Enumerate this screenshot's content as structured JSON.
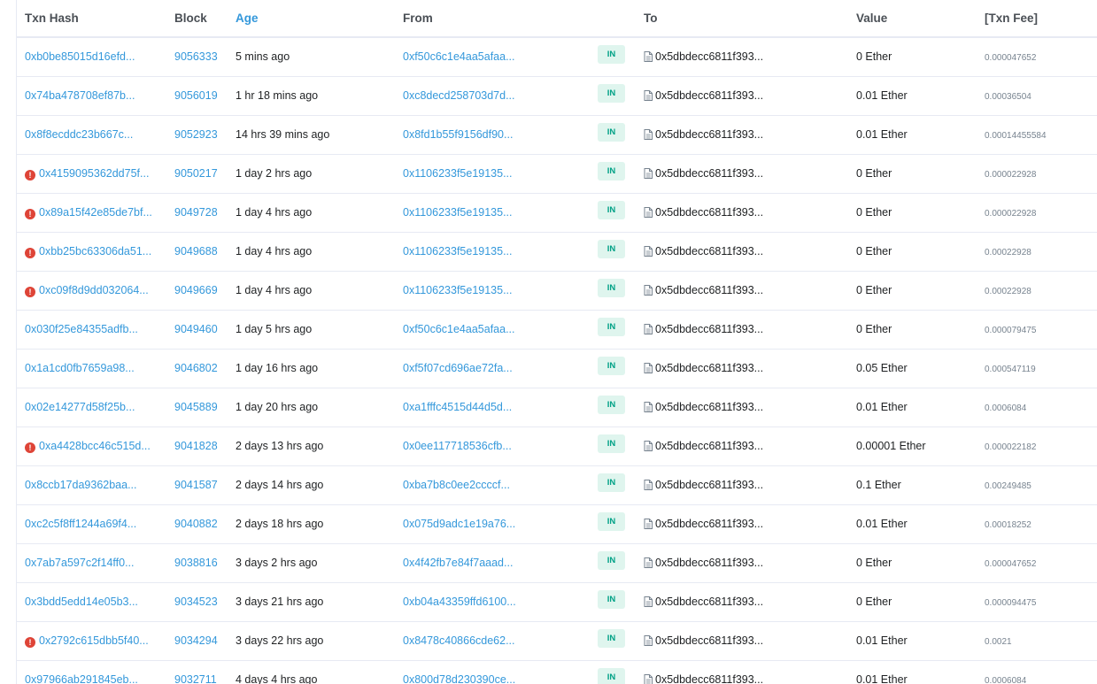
{
  "headers": {
    "txn_hash": "Txn Hash",
    "block": "Block",
    "age": "Age",
    "from": "From",
    "to": "To",
    "value": "Value",
    "txn_fee": "[Txn Fee]"
  },
  "rows": [
    {
      "hash": "0xb0be85015d16efd...",
      "error": false,
      "block": "9056333",
      "age": "5 mins ago",
      "from": "0xf50c6c1e4aa5afaa...",
      "direction": "IN",
      "to": "0x5dbdecc6811f393...",
      "value": "0 Ether",
      "fee": "0.000047652"
    },
    {
      "hash": "0x74ba478708ef87b...",
      "error": false,
      "block": "9056019",
      "age": "1 hr 18 mins ago",
      "from": "0xc8decd258703d7d...",
      "direction": "IN",
      "to": "0x5dbdecc6811f393...",
      "value": "0.01 Ether",
      "fee": "0.00036504"
    },
    {
      "hash": "0x8f8ecddc23b667c...",
      "error": false,
      "block": "9052923",
      "age": "14 hrs 39 mins ago",
      "from": "0x8fd1b55f9156df90...",
      "direction": "IN",
      "to": "0x5dbdecc6811f393...",
      "value": "0.01 Ether",
      "fee": "0.00014455584"
    },
    {
      "hash": "0x4159095362dd75f...",
      "error": true,
      "block": "9050217",
      "age": "1 day 2 hrs ago",
      "from": "0x1106233f5e19135...",
      "direction": "IN",
      "to": "0x5dbdecc6811f393...",
      "value": "0 Ether",
      "fee": "0.000022928"
    },
    {
      "hash": "0x89a15f42e85de7bf...",
      "error": true,
      "block": "9049728",
      "age": "1 day 4 hrs ago",
      "from": "0x1106233f5e19135...",
      "direction": "IN",
      "to": "0x5dbdecc6811f393...",
      "value": "0 Ether",
      "fee": "0.000022928"
    },
    {
      "hash": "0xbb25bc63306da51...",
      "error": true,
      "block": "9049688",
      "age": "1 day 4 hrs ago",
      "from": "0x1106233f5e19135...",
      "direction": "IN",
      "to": "0x5dbdecc6811f393...",
      "value": "0 Ether",
      "fee": "0.00022928"
    },
    {
      "hash": "0xc09f8d9dd032064...",
      "error": true,
      "block": "9049669",
      "age": "1 day 4 hrs ago",
      "from": "0x1106233f5e19135...",
      "direction": "IN",
      "to": "0x5dbdecc6811f393...",
      "value": "0 Ether",
      "fee": "0.00022928"
    },
    {
      "hash": "0x030f25e84355adfb...",
      "error": false,
      "block": "9049460",
      "age": "1 day 5 hrs ago",
      "from": "0xf50c6c1e4aa5afaa...",
      "direction": "IN",
      "to": "0x5dbdecc6811f393...",
      "value": "0 Ether",
      "fee": "0.000079475"
    },
    {
      "hash": "0x1a1cd0fb7659a98...",
      "error": false,
      "block": "9046802",
      "age": "1 day 16 hrs ago",
      "from": "0xf5f07cd696ae72fa...",
      "direction": "IN",
      "to": "0x5dbdecc6811f393...",
      "value": "0.05 Ether",
      "fee": "0.000547119"
    },
    {
      "hash": "0x02e14277d58f25b...",
      "error": false,
      "block": "9045889",
      "age": "1 day 20 hrs ago",
      "from": "0xa1fffc4515d44d5d...",
      "direction": "IN",
      "to": "0x5dbdecc6811f393...",
      "value": "0.01 Ether",
      "fee": "0.0006084"
    },
    {
      "hash": "0xa4428bcc46c515d...",
      "error": true,
      "block": "9041828",
      "age": "2 days 13 hrs ago",
      "from": "0x0ee117718536cfb...",
      "direction": "IN",
      "to": "0x5dbdecc6811f393...",
      "value": "0.00001 Ether",
      "fee": "0.000022182"
    },
    {
      "hash": "0x8ccb17da9362baa...",
      "error": false,
      "block": "9041587",
      "age": "2 days 14 hrs ago",
      "from": "0xba7b8c0ee2ccccf...",
      "direction": "IN",
      "to": "0x5dbdecc6811f393...",
      "value": "0.1 Ether",
      "fee": "0.00249485"
    },
    {
      "hash": "0xc2c5f8ff1244a69f4...",
      "error": false,
      "block": "9040882",
      "age": "2 days 18 hrs ago",
      "from": "0x075d9adc1e19a76...",
      "direction": "IN",
      "to": "0x5dbdecc6811f393...",
      "value": "0.01 Ether",
      "fee": "0.00018252"
    },
    {
      "hash": "0x7ab7a597c2f14ff0...",
      "error": false,
      "block": "9038816",
      "age": "3 days 2 hrs ago",
      "from": "0x4f42fb7e84f7aaad...",
      "direction": "IN",
      "to": "0x5dbdecc6811f393...",
      "value": "0 Ether",
      "fee": "0.000047652"
    },
    {
      "hash": "0x3bdd5edd14e05b3...",
      "error": false,
      "block": "9034523",
      "age": "3 days 21 hrs ago",
      "from": "0xb04a43359ffd6100...",
      "direction": "IN",
      "to": "0x5dbdecc6811f393...",
      "value": "0 Ether",
      "fee": "0.000094475"
    },
    {
      "hash": "0x2792c615dbb5f40...",
      "error": true,
      "block": "9034294",
      "age": "3 days 22 hrs ago",
      "from": "0x8478c40866cde62...",
      "direction": "IN",
      "to": "0x5dbdecc6811f393...",
      "value": "0.01 Ether",
      "fee": "0.0021"
    },
    {
      "hash": "0x97966ab291845eb...",
      "error": false,
      "block": "9032711",
      "age": "4 days 4 hrs ago",
      "from": "0x800d78d230390ce...",
      "direction": "IN",
      "to": "0x5dbdecc6811f393...",
      "value": "0.01 Ether",
      "fee": "0.0006084"
    }
  ],
  "icons": {
    "error": "exclamation-circle-icon",
    "contract": "document-icon"
  },
  "colors": {
    "link": "#3498db",
    "error": "#de4437",
    "in_badge_bg": "#dff5ee",
    "in_badge_text": "#00a186"
  }
}
